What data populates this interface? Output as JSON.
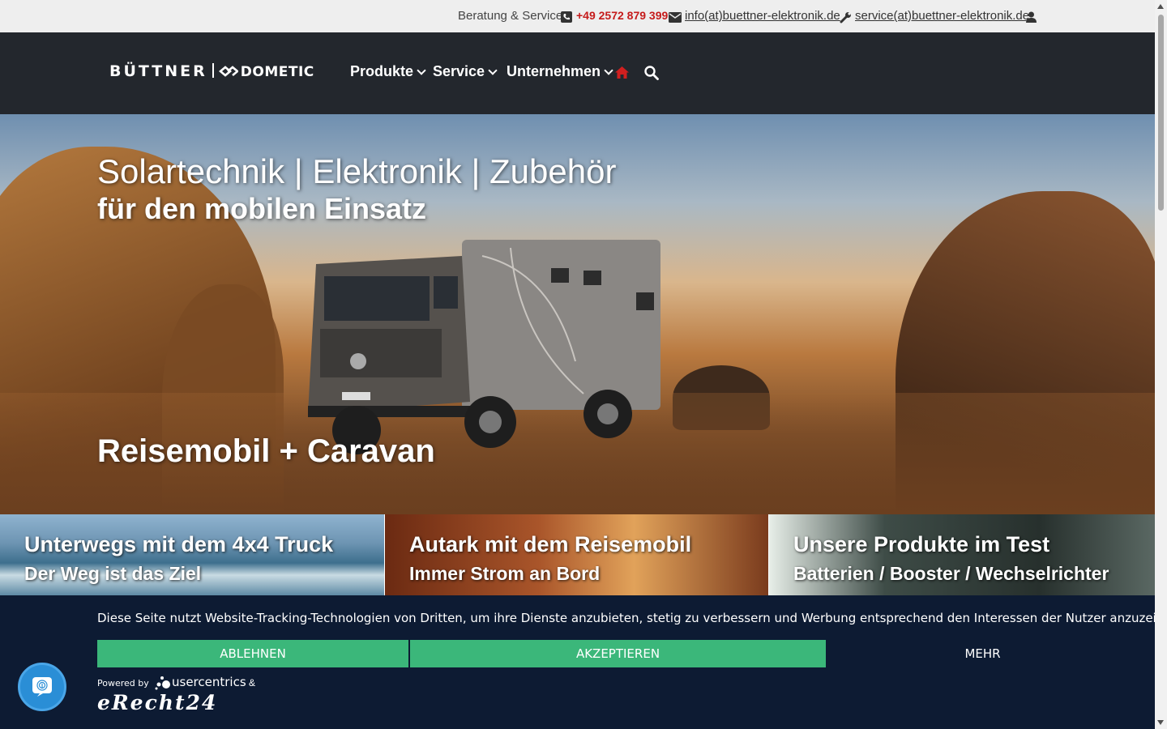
{
  "topbar": {
    "consult_label": "Beratung & Service",
    "phone": "+49 2572 879 399",
    "email": "info(at)buettner-elektronik.de",
    "service_email": "service(at)buettner-elektronik.de"
  },
  "logo": {
    "brand": "BÜTTNER",
    "partner": "DOMETIC"
  },
  "nav": {
    "items": [
      {
        "label": "Produkte"
      },
      {
        "label": "Service"
      },
      {
        "label": "Unternehmen"
      }
    ],
    "icons": [
      "home-icon",
      "search-icon"
    ],
    "home_color": "#d01f1f"
  },
  "hero": {
    "title": "Solartechnik | Elektronik | Zubehör",
    "subtitle": "für den mobilen Einsatz",
    "caption": "Reisemobil + Caravan"
  },
  "tiles": [
    {
      "title": "Unterwegs mit dem 4x4 Truck",
      "subtitle": "Der Weg ist das Ziel"
    },
    {
      "title": "Autark mit dem Reisemobil",
      "subtitle": "Immer Strom an Bord"
    },
    {
      "title": "Unsere Produkte im Test",
      "subtitle": "Batterien / Booster / Wechselrichter"
    }
  ],
  "cookie": {
    "text": "Diese Seite nutzt Website-Tracking-Technologien von Dritten, um ihre Dienste anzubieten, stetig zu verbessern und Werbung entsprechend den Interessen der Nutzer anzuzeigen.",
    "decline": "ABLEHNEN",
    "accept": "AKZEPTIEREN",
    "more": "MEHR",
    "powered_by": "Powered by",
    "usercentrics": "usercentrics",
    "amp": "&",
    "erecht": "eRecht24",
    "button_color": "#3bb77a",
    "background": "#0d1b33"
  }
}
